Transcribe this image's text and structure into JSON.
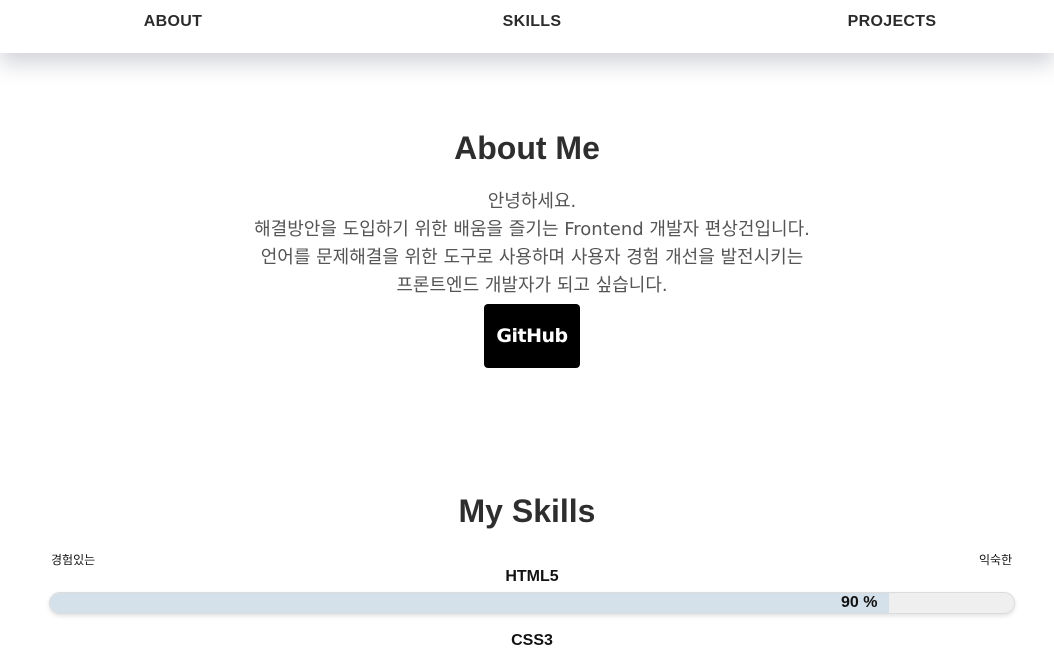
{
  "nav": {
    "items": [
      {
        "label": "ABOUT"
      },
      {
        "label": "SKILLS"
      },
      {
        "label": "PROJECTS"
      }
    ]
  },
  "about": {
    "title": "About Me",
    "lines": [
      "안녕하세요.",
      "해결방안을 도입하기 위한 배움을 즐기는 Frontend 개발자 편상건입니다.",
      "언어를 문제해결을 위한 도구로 사용하며 사용자 경험 개선을 발전시키는",
      "프론트엔드 개발자가 되고 싶습니다."
    ],
    "github_label": "GitHub"
  },
  "skills": {
    "title": "My Skills",
    "scale_left": "경험있는",
    "scale_right": "익숙한",
    "items": [
      {
        "name": "HTML5",
        "percent": 90,
        "percent_label": "90 %"
      },
      {
        "name": "CSS3"
      }
    ]
  }
}
